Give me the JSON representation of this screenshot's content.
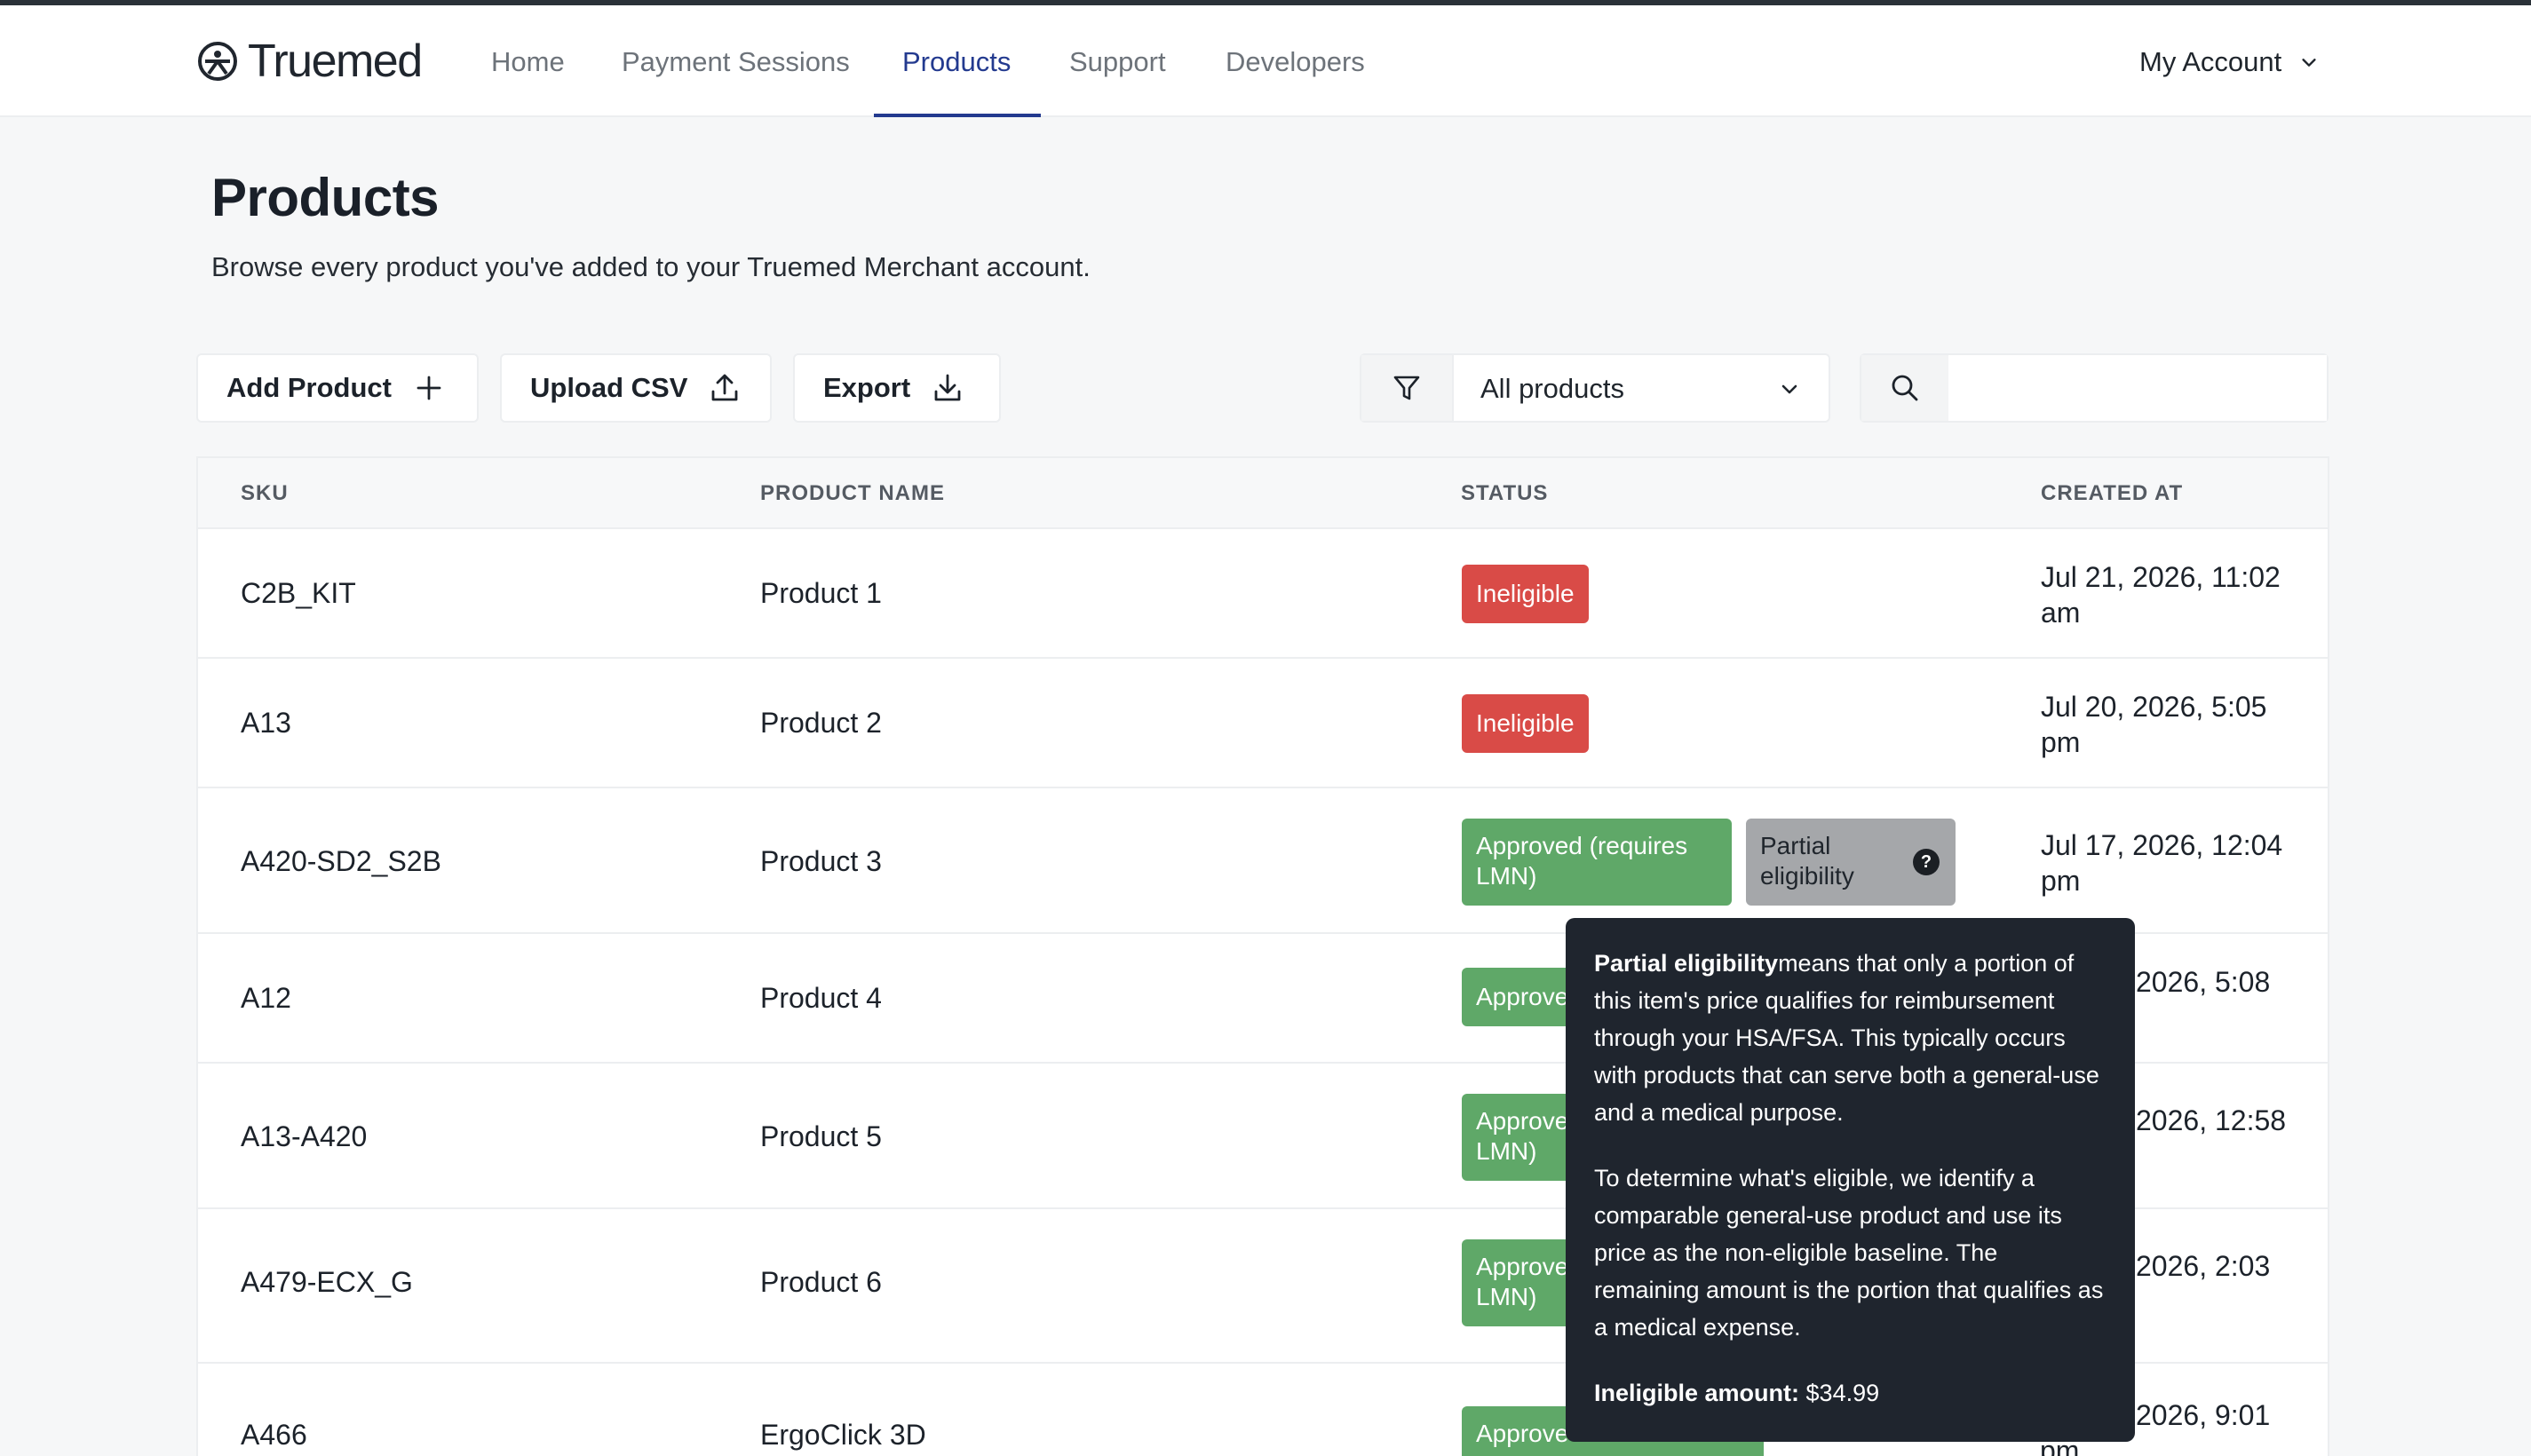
{
  "app": {
    "brand": "Truemed"
  },
  "nav": {
    "items": [
      {
        "label": "Home"
      },
      {
        "label": "Payment Sessions"
      },
      {
        "label": "Products"
      },
      {
        "label": "Support"
      },
      {
        "label": "Developers"
      }
    ],
    "active": "Products",
    "account_label": "My Account"
  },
  "page": {
    "title": "Products",
    "subtitle": "Browse every product you've added to your Truemed Merchant account."
  },
  "toolbar": {
    "add_label": "Add Product",
    "upload_label": "Upload CSV",
    "export_label": "Export",
    "filter_value": "All products",
    "search_value": ""
  },
  "table": {
    "headers": [
      "SKU",
      "PRODUCT NAME",
      "STATUS",
      "CREATED AT"
    ],
    "rows": [
      {
        "sku": "C2B_KIT",
        "name": "Product 1",
        "status": "Ineligible",
        "created_1": "Jul 21, 2026, 11:02",
        "created_2": "am"
      },
      {
        "sku": "A13",
        "name": "Product 2",
        "status": "Ineligible",
        "created_1": "Jul 20, 2026, 5:05",
        "created_2": "pm"
      },
      {
        "sku": "A420-SD2_S2B",
        "name": "Product 3",
        "status_1": "Approved (requires",
        "status_2": "LMN)",
        "partial_1": "Partial",
        "partial_2": "eligibility",
        "created_1": "Jul 17, 2026, 12:04",
        "created_2": "pm"
      },
      {
        "sku": "A12",
        "name": "Product 4",
        "status": "Approve",
        "created_1": "2026, 5:08"
      },
      {
        "sku": "A13-A420",
        "name": "Product 5",
        "status_1": "Approve",
        "status_2": "LMN)",
        "created_1": "2026, 12:58"
      },
      {
        "sku": "A479-ECX_G",
        "name": "Product 6",
        "status_1": "Approve",
        "status_2": "LMN)",
        "created_1": "2026, 2:03"
      },
      {
        "sku": "A466",
        "name": "ErgoClick 3D",
        "status": "Approve",
        "created_1": "2026, 9:01",
        "created_2": "pm"
      }
    ]
  },
  "tooltip": {
    "term": "Partial eligibility",
    "p1_rest": "means that only a portion of this item's price qualifies for reimbursement through your HSA/FSA. This typically occurs with products that can serve both a general-use and a medical purpose.",
    "p2": "To determine what's eligible, we identify a comparable general-use product and use its price as the non-eligible baseline. The remaining amount is the portion that qualifies as a medical expense.",
    "amount_label": "Ineligible amount:",
    "amount_value": "$34.99"
  },
  "colors": {
    "accent": "#233a8f",
    "ineligible": "#d94b47",
    "approved": "#5fa868",
    "partial": "#a5a7aa",
    "tooltip_bg": "#1f252e"
  },
  "icons": [
    "truemed-logo-icon",
    "chevron-down-icon",
    "plus-icon",
    "upload-icon",
    "download-icon",
    "filter-icon",
    "search-icon",
    "question-icon"
  ]
}
